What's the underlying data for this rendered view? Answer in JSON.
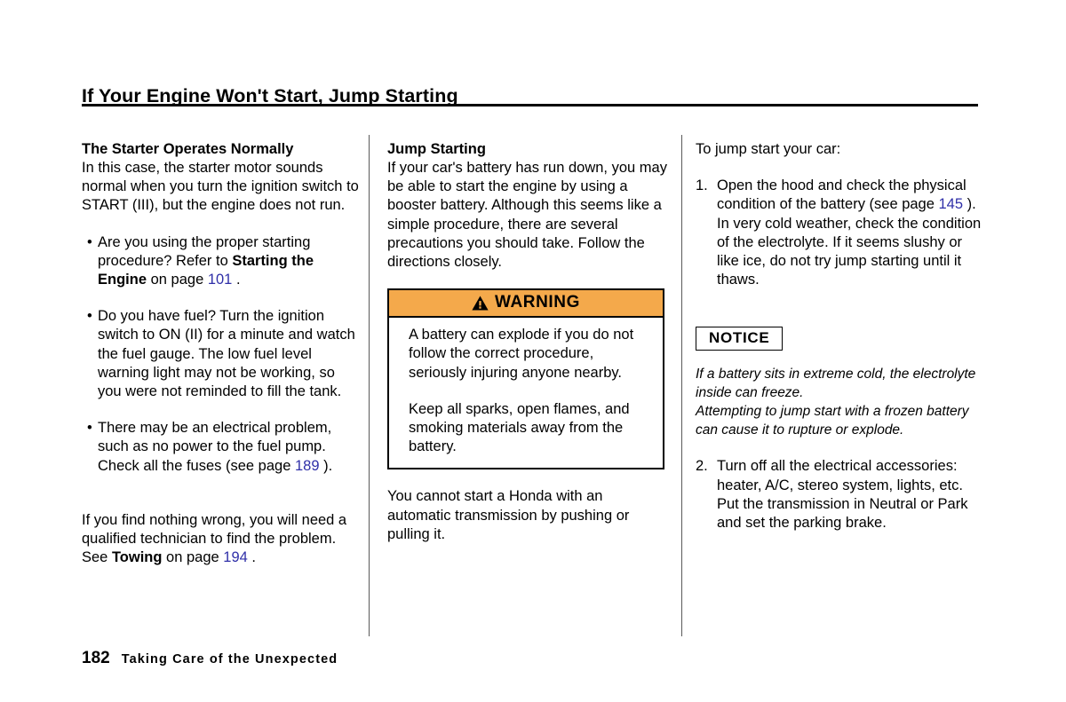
{
  "header": {
    "title": "If Your Engine Won't Start, Jump Starting"
  },
  "colors": {
    "warning_header_background": "#f4a94b",
    "page_reference_link": "#2f2fa8",
    "rule": "#000000",
    "divider": "#5a5a5a"
  },
  "column_1": {
    "heading": "The Starter Operates Normally",
    "intro": "In this case, the starter motor sounds normal when you turn the ignition switch to START (III), but the engine does not run.",
    "bullets": [
      {
        "marker": "•",
        "text_part_1": "Are you using the proper starting procedure? Refer to ",
        "bold_1": "Starting the Engine",
        "text_part_2": " on page ",
        "page_ref": "101",
        "text_part_3": " ."
      },
      {
        "marker": "•",
        "text_part_1": "Do you have fuel? Turn the ignition switch to ON (II) for a minute and watch the fuel gauge. The low fuel level warning light may not be working, so you were not reminded to fill the tank.",
        "bold_1": "",
        "text_part_2": "",
        "page_ref": "",
        "text_part_3": ""
      },
      {
        "marker": "•",
        "text_part_1": "There may be an electrical problem, such as no power to the fuel pump. Check all the fuses (see page ",
        "bold_1": "",
        "text_part_2": "",
        "page_ref": "189",
        "text_part_3": " )."
      }
    ],
    "closing_part_1": "If you find nothing wrong, you will need a qualified technician to find the problem. See ",
    "closing_bold": "Towing",
    "closing_part_2": " on page ",
    "closing_page_ref": "194",
    "closing_part_3": " ."
  },
  "column_2": {
    "heading": "Jump Starting",
    "intro": "If your car's battery has run down, you may be able to start the engine by using a booster battery. Although this seems like a simple procedure, there are several precautions you should take. Follow the directions closely.",
    "warning": {
      "icon_label": "warning-triangle-icon",
      "title": "WARNING",
      "paragraph_1": "A battery can explode if you do not follow the correct procedure, seriously injuring anyone nearby.",
      "paragraph_2": "Keep all sparks, open flames, and smoking materials away from the battery."
    },
    "closing": "You cannot start a Honda with an automatic transmission by pushing or pulling it."
  },
  "column_3": {
    "intro": "To jump start your car:",
    "steps": [
      {
        "number": "1.",
        "text_part_1": "Open the hood and check the physical condition of the battery (see page ",
        "page_ref": "145",
        "text_part_2": " ). In very cold weather, check the condition of the electrolyte. If it seems slushy or like ice, do not try jump starting until it thaws."
      },
      {
        "number": "2.",
        "text_part_1": "Turn off all the electrical accessories: heater, A/C, stereo system, lights, etc.",
        "page_ref": "",
        "text_part_2": ""
      }
    ],
    "step_2_extra": "Put the transmission in Neutral or Park and set the parking brake.",
    "notice": {
      "label": "NOTICE",
      "line_1": "If a battery sits in extreme cold, the electrolyte inside can freeze.",
      "line_2": "Attempting to jump start with a frozen battery can cause it to rupture or explode."
    }
  },
  "footer": {
    "page_number": "182",
    "section_title": "Taking Care of the Unexpected"
  }
}
